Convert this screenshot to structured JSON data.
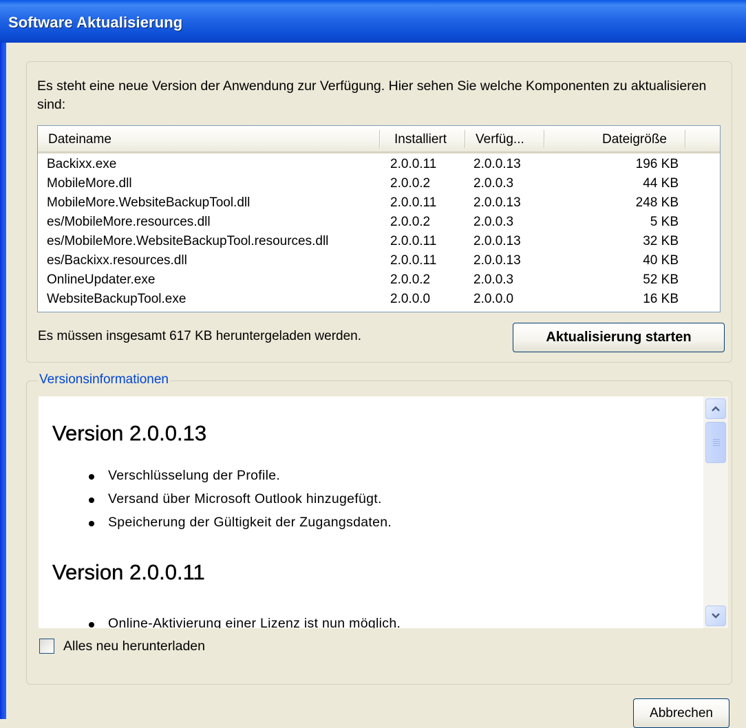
{
  "window": {
    "title": "Software Aktualisierung"
  },
  "update": {
    "intro": "Es steht eine neue Version der Anwendung zur Verfügung. Hier sehen Sie welche Komponenten zu aktualisieren sind:",
    "columns": {
      "name": "Dateiname",
      "installed": "Installiert",
      "available": "Verfüg...",
      "size": "Dateigröße"
    },
    "files": [
      {
        "name": "Backixx.exe",
        "installed": "2.0.0.11",
        "available": "2.0.0.13",
        "size": "196 KB"
      },
      {
        "name": "MobileMore.dll",
        "installed": "2.0.0.2",
        "available": "2.0.0.3",
        "size": "44 KB"
      },
      {
        "name": "MobileMore.WebsiteBackupTool.dll",
        "installed": "2.0.0.11",
        "available": "2.0.0.13",
        "size": "248 KB"
      },
      {
        "name": "es/MobileMore.resources.dll",
        "installed": "2.0.0.2",
        "available": "2.0.0.3",
        "size": "5 KB"
      },
      {
        "name": "es/MobileMore.WebsiteBackupTool.resources.dll",
        "installed": "2.0.0.11",
        "available": "2.0.0.13",
        "size": "32 KB"
      },
      {
        "name": "es/Backixx.resources.dll",
        "installed": "2.0.0.11",
        "available": "2.0.0.13",
        "size": "40 KB"
      },
      {
        "name": "OnlineUpdater.exe",
        "installed": "2.0.0.2",
        "available": "2.0.0.3",
        "size": "52 KB"
      },
      {
        "name": "WebsiteBackupTool.exe",
        "installed": "2.0.0.0",
        "available": "2.0.0.0",
        "size": "16 KB"
      }
    ],
    "total_text": "Es müssen insgesamt 617 KB heruntergeladen werden.",
    "start_button": "Aktualisierung starten"
  },
  "version_info": {
    "legend": "Versionsinformationen",
    "releases": [
      {
        "heading": "Version 2.0.0.13",
        "items": [
          "Verschlüsselung der Profile.",
          "Versand über Microsoft Outlook hinzugefügt.",
          "Speicherung der Gültigkeit der Zugangsdaten."
        ]
      },
      {
        "heading": "Version 2.0.0.11",
        "items": [
          "Online-Aktivierung einer Lizenz ist nun möglich."
        ]
      }
    ],
    "checkbox_label": "Alles neu herunterladen",
    "checkbox_checked": false
  },
  "footer": {
    "cancel_button": "Abbrechen"
  }
}
